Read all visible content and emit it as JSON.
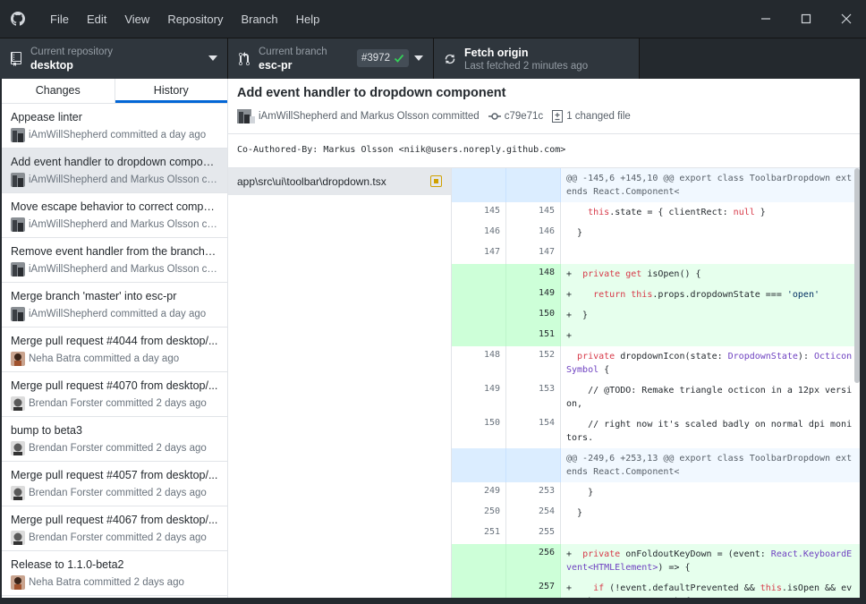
{
  "menu": [
    "File",
    "Edit",
    "View",
    "Repository",
    "Branch",
    "Help"
  ],
  "toolbar": {
    "repo_label": "Current repository",
    "repo_value": "desktop",
    "branch_label": "Current branch",
    "branch_value": "esc-pr",
    "pr_number": "#3972",
    "fetch_title": "Fetch origin",
    "fetch_sub": "Last fetched 2 minutes ago"
  },
  "tabs": {
    "changes": "Changes",
    "history": "History"
  },
  "commits": [
    {
      "summary": "Appease linter",
      "author": "iAmWillShepherd committed a day ago"
    },
    {
      "summary": "Add event handler to dropdown compon...",
      "author": "iAmWillShepherd and Markus Olsson co..."
    },
    {
      "summary": "Move escape behavior to correct compo...",
      "author": "iAmWillShepherd and Markus Olsson co..."
    },
    {
      "summary": "Remove event handler from the branches...",
      "author": "iAmWillShepherd and Markus Olsson co..."
    },
    {
      "summary": "Merge branch 'master' into esc-pr",
      "author": "iAmWillShepherd committed a day ago"
    },
    {
      "summary": "Merge pull request #4044 from desktop/...",
      "author": "Neha Batra committed a day ago"
    },
    {
      "summary": "Merge pull request #4070 from desktop/...",
      "author": "Brendan Forster committed 2 days ago"
    },
    {
      "summary": "bump to beta3",
      "author": "Brendan Forster committed 2 days ago"
    },
    {
      "summary": "Merge pull request #4057 from desktop/...",
      "author": "Brendan Forster committed 2 days ago"
    },
    {
      "summary": "Merge pull request #4067 from desktop/...",
      "author": "Brendan Forster committed 2 days ago"
    },
    {
      "summary": "Release to 1.1.0-beta2",
      "author": "Neha Batra committed 2 days ago"
    }
  ],
  "commit": {
    "title": "Add event handler to dropdown component",
    "authors": "iAmWillShepherd and Markus Olsson committed",
    "sha": "c79e71c",
    "changed": "1 changed file",
    "description": "Co-Authored-By: Markus Olsson <niik@users.noreply.github.com>"
  },
  "file": {
    "path": "app\\src\\ui\\toolbar\\dropdown.tsx"
  },
  "colors": {
    "accent": "#0366d6",
    "added": "#e6ffed",
    "hunk": "#f1f8ff",
    "chrome": "#24292e"
  }
}
